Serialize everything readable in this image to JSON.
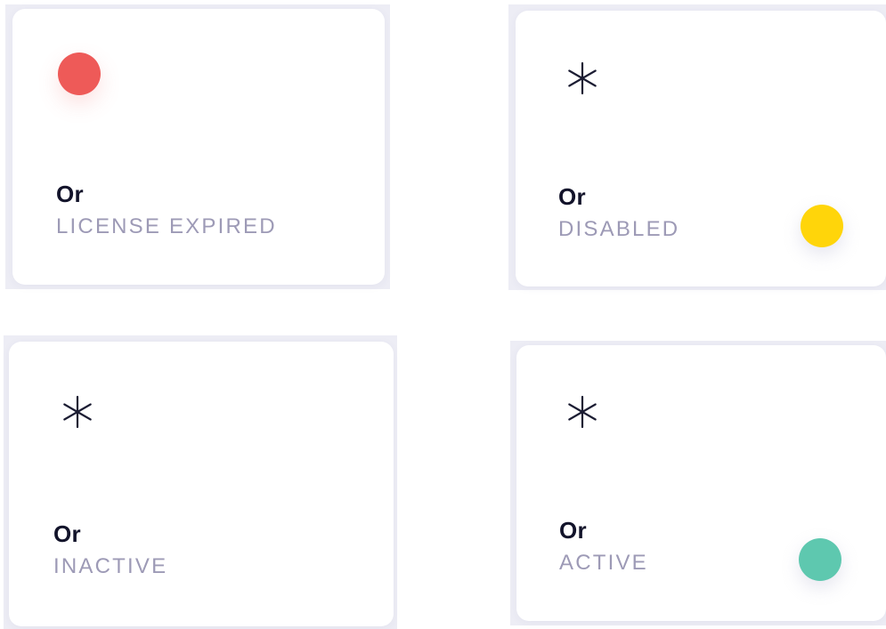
{
  "colors": {
    "expired": "#ee5a58",
    "disabled": "#ffd50a",
    "active": "#5ec8af",
    "title": "#12132a",
    "status": "#9d9ab6"
  },
  "cards": [
    {
      "name": "Or",
      "status": "LICENSE EXPIRED",
      "icon": "red-dot-icon"
    },
    {
      "name": "Or",
      "status": "DISABLED",
      "icon": "asterisk-icon",
      "indicator": "yellow-dot-icon"
    },
    {
      "name": "Or",
      "status": "INACTIVE",
      "icon": "asterisk-icon"
    },
    {
      "name": "Or",
      "status": "ACTIVE",
      "icon": "asterisk-icon",
      "indicator": "green-dot-icon"
    }
  ]
}
